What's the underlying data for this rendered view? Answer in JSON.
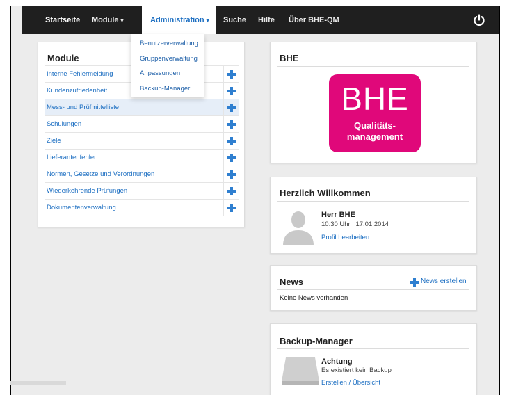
{
  "navbar": {
    "items": [
      {
        "label": "Startseite"
      },
      {
        "label": "Module",
        "caret": "▾"
      },
      {
        "label": "Administration",
        "caret": "▾"
      },
      {
        "label": "Suche"
      },
      {
        "label": "Hilfe"
      },
      {
        "label": "Über BHE-QM"
      }
    ],
    "power_icon": "power-icon"
  },
  "admin_menu": {
    "items": [
      {
        "label": "Benutzerverwaltung"
      },
      {
        "label": "Gruppenverwaltung"
      },
      {
        "label": "Anpassungen"
      },
      {
        "label": "Backup-Manager"
      }
    ]
  },
  "modules": {
    "title": "Module",
    "items": [
      {
        "label": "Interne Fehlermeldung"
      },
      {
        "label": "Kundenzufriedenheit"
      },
      {
        "label": "Mess- und Prüfmittelliste"
      },
      {
        "label": "Schulungen"
      },
      {
        "label": "Ziele"
      },
      {
        "label": "Lieferantenfehler"
      },
      {
        "label": "Normen, Gesetze und Verordnungen"
      },
      {
        "label": "Wiederkehrende Prüfungen"
      },
      {
        "label": "Dokumentenverwaltung"
      }
    ]
  },
  "bhe": {
    "title": "BHE",
    "logo_big": "BHE",
    "logo_sub_1": "Qualitäts-",
    "logo_sub_2": "management",
    "logo_color": "#e0087a"
  },
  "welcome": {
    "title": "Herzlich Willkommen",
    "user_name": "Herr BHE",
    "time": "10:30 Uhr | 17.01.2014",
    "profile_link": "Profil bearbeiten"
  },
  "news": {
    "title": "News",
    "create_label": "News erstellen",
    "empty_text": "Keine News vorhanden"
  },
  "backup": {
    "title": "Backup-Manager",
    "warning_title": "Achtung",
    "warning_text": "Es existiert kein Backup",
    "link": "Erstellen / Übersicht"
  },
  "colors": {
    "navbar_bg": "#1f1f1f",
    "link": "#1d6fc2",
    "accent": "#2f7fd0",
    "page_bg": "#ececec"
  }
}
